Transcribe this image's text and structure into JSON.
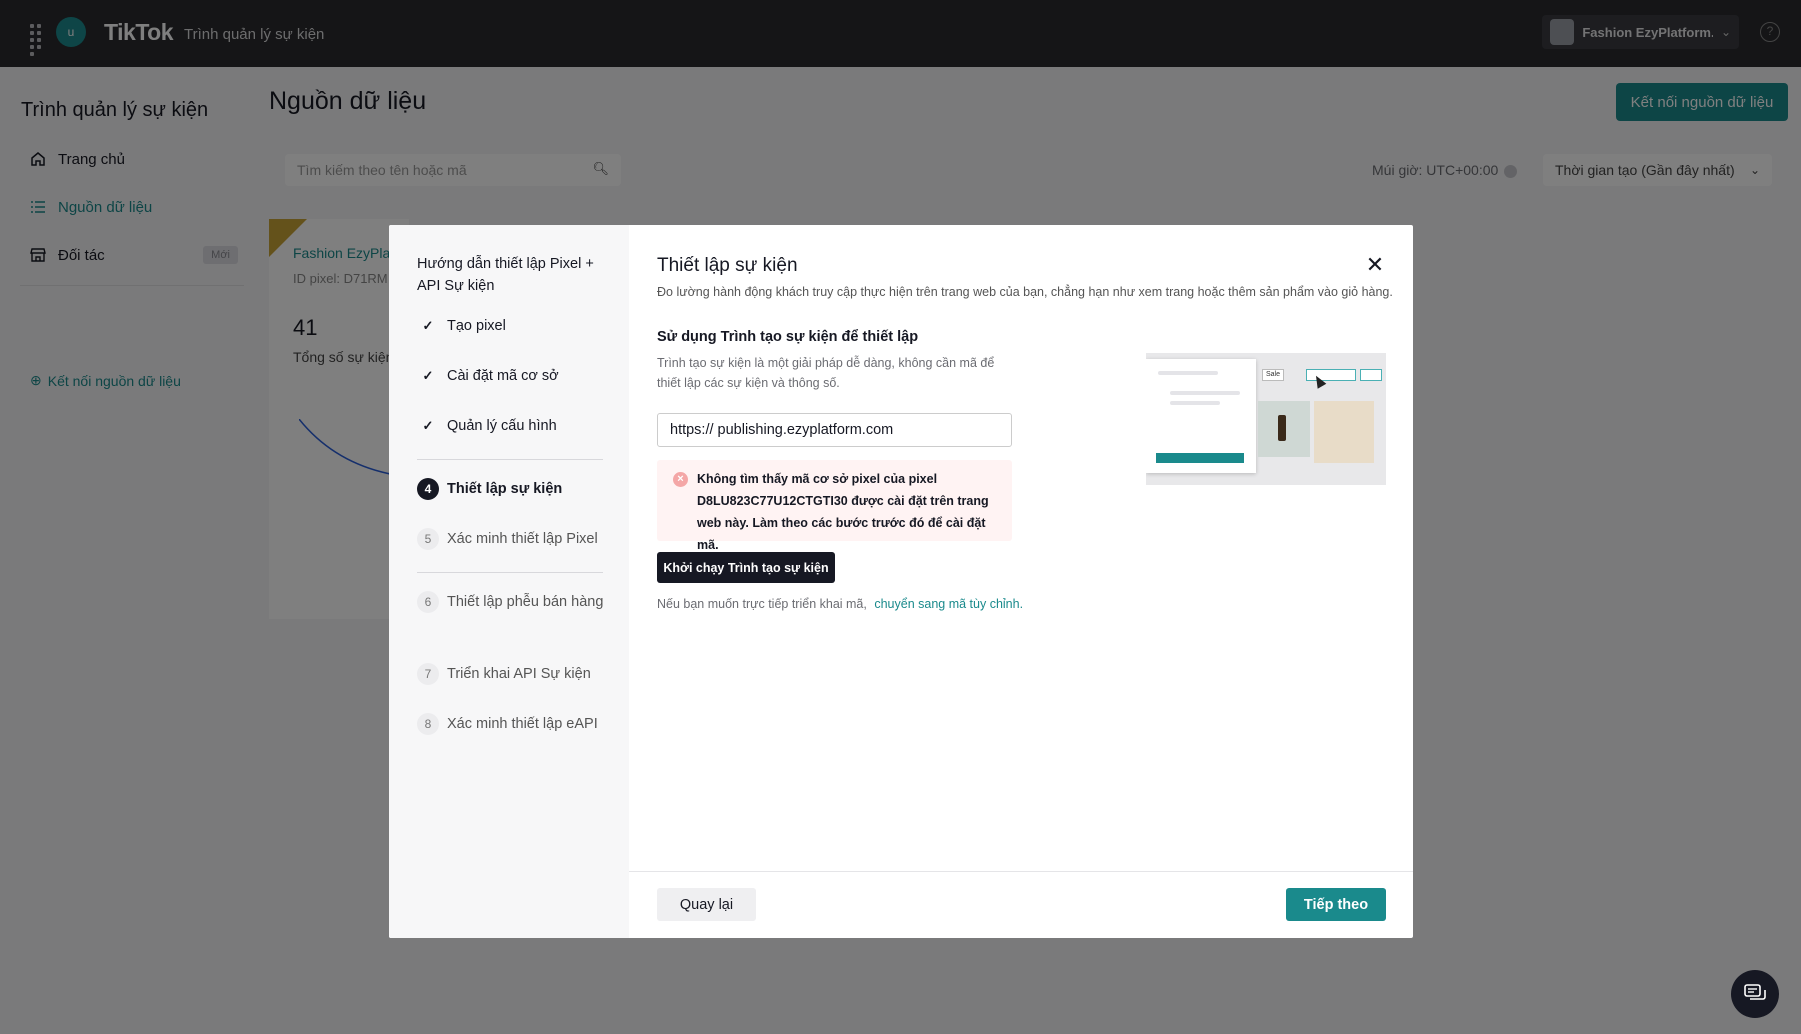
{
  "topbar": {
    "app_initial": "u",
    "logo": "TikTok",
    "logo_sub": "Trình quản lý sự kiện",
    "account_name": "Fashion EzyPlatform...",
    "help": "?"
  },
  "sidebar": {
    "title": "Trình quản lý sự kiện",
    "items": [
      {
        "label": "Trang chủ",
        "icon": "home-icon"
      },
      {
        "label": "Nguồn dữ liệu",
        "icon": "list-icon"
      },
      {
        "label": "Đối tác",
        "icon": "store-icon",
        "badge": "Mới"
      }
    ],
    "connect_link": "Kết nối nguồn dữ liệu"
  },
  "main": {
    "title": "Nguồn dữ liệu",
    "connect_button": "Kết nối nguồn dữ liệu",
    "search_placeholder": "Tìm kiếm theo tên hoặc mã",
    "timezone": "Múi giờ: UTC+00:00",
    "sort": "Thời gian tạo (Gần đây nhất)",
    "card": {
      "name": "Fashion EzyPla",
      "pixel_id": "ID pixel: D71RM",
      "count": "41",
      "count_label": "Tổng số sự kiện"
    }
  },
  "modal": {
    "left_title": "Hướng dẫn thiết lập Pixel + API Sự kiện",
    "steps": [
      {
        "label": "Tạo pixel",
        "state": "done",
        "marker": "✓"
      },
      {
        "label": "Cài đặt mã cơ sở",
        "state": "done",
        "marker": "✓"
      },
      {
        "label": "Quản lý cấu hình",
        "state": "done",
        "marker": "✓"
      },
      {
        "label": "Thiết lập sự kiện",
        "state": "current",
        "marker": "4"
      },
      {
        "label": "Xác minh thiết lập Pixel",
        "state": "pending",
        "marker": "5"
      },
      {
        "label": "Thiết lập phễu bán hàng",
        "state": "pending",
        "marker": "6"
      },
      {
        "label": "Triển khai API Sự kiện",
        "state": "pending",
        "marker": "7"
      },
      {
        "label": "Xác minh thiết lập eAPI",
        "state": "pending",
        "marker": "8"
      }
    ],
    "title": "Thiết lập sự kiện",
    "description": "Đo lường hành động khách truy cập thực hiện trên trang web của bạn, chẳng hạn như xem trang hoặc thêm sản phẩm vào giỏ hàng.",
    "section_title": "Sử dụng Trình tạo sự kiện để thiết lập",
    "section_desc": "Trình tạo sự kiện là một giải pháp dễ dàng, không cần mã để thiết lập các sự kiện và thông số.",
    "url_prefix": "https://",
    "url_value": "publishing.ezyplatform.com",
    "error_text": "Không tìm thấy mã cơ sở pixel của pixel D8LU823C77U12CTGTI30 được cài đặt trên trang web này. Làm theo các bước trước đó để cài đặt mã.",
    "launch_button": "Khởi chạy Trình tạo sự kiện",
    "hint_text": "Nếu bạn muốn trực tiếp triển khai mã,",
    "hint_link": "chuyển sang mã tùy chỉnh.",
    "preview_sale": "Sale",
    "back_button": "Quay lại",
    "next_button": "Tiếp theo"
  },
  "colors": {
    "accent": "#1a8a8c",
    "dark": "#161823",
    "warning": "#c9a436"
  }
}
